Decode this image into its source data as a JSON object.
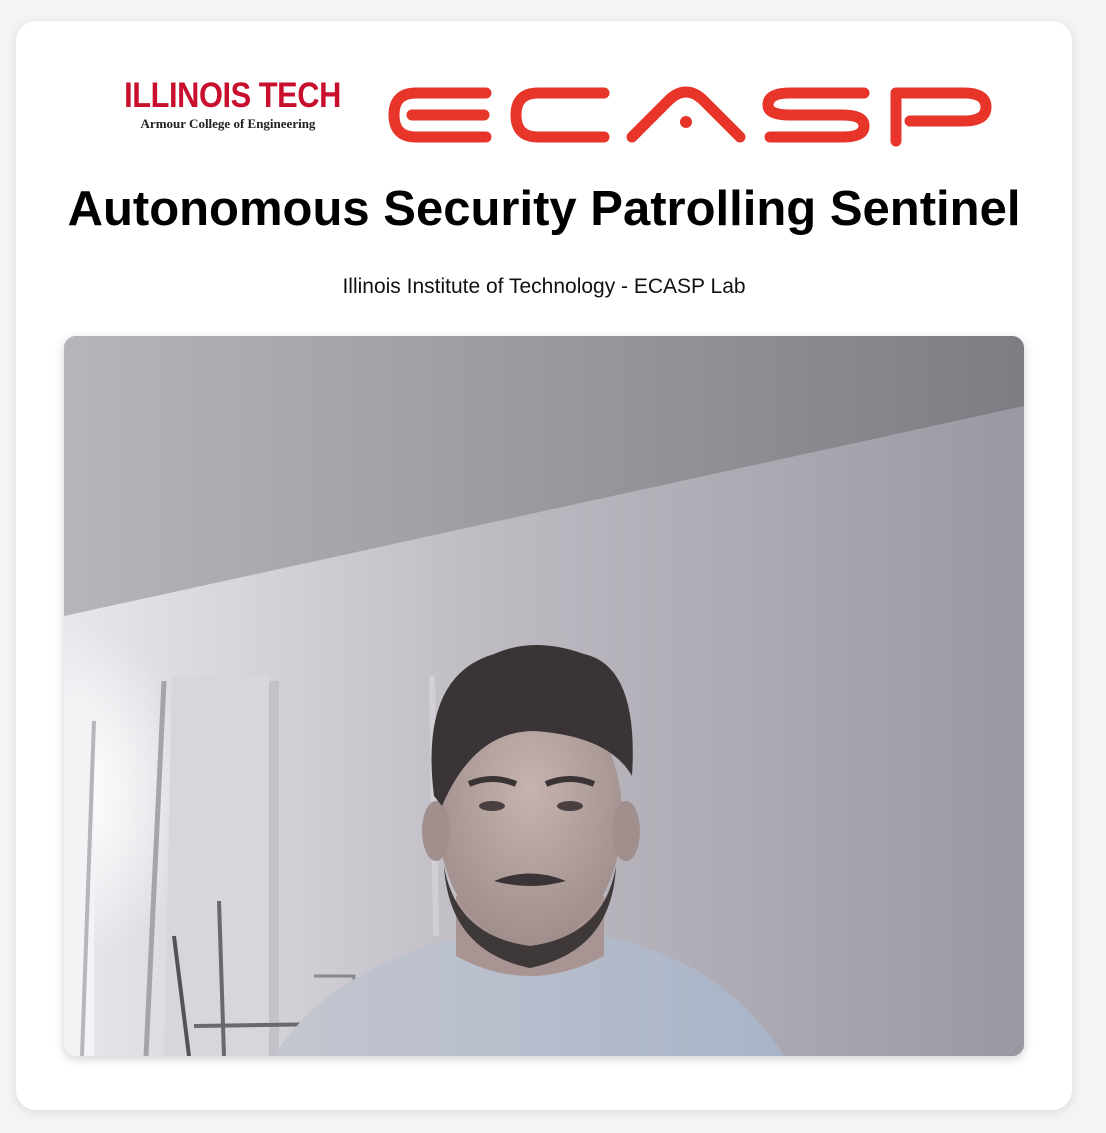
{
  "logos": {
    "illinois_tech": "ILLINOIS TECH",
    "illinois_tech_sub": "Armour College of Engineering",
    "ecasp": "ECASP"
  },
  "header": {
    "title": "Autonomous Security Patrolling Sentinel",
    "subtitle": "Illinois Institute of Technology - ECASP Lab"
  },
  "colors": {
    "illinois_red": "#c8102e",
    "ecasp_red": "#e8352a",
    "card_background": "#ffffff",
    "page_background": "#f4f4f4"
  },
  "video_feed": {
    "content": "live camera stream"
  }
}
